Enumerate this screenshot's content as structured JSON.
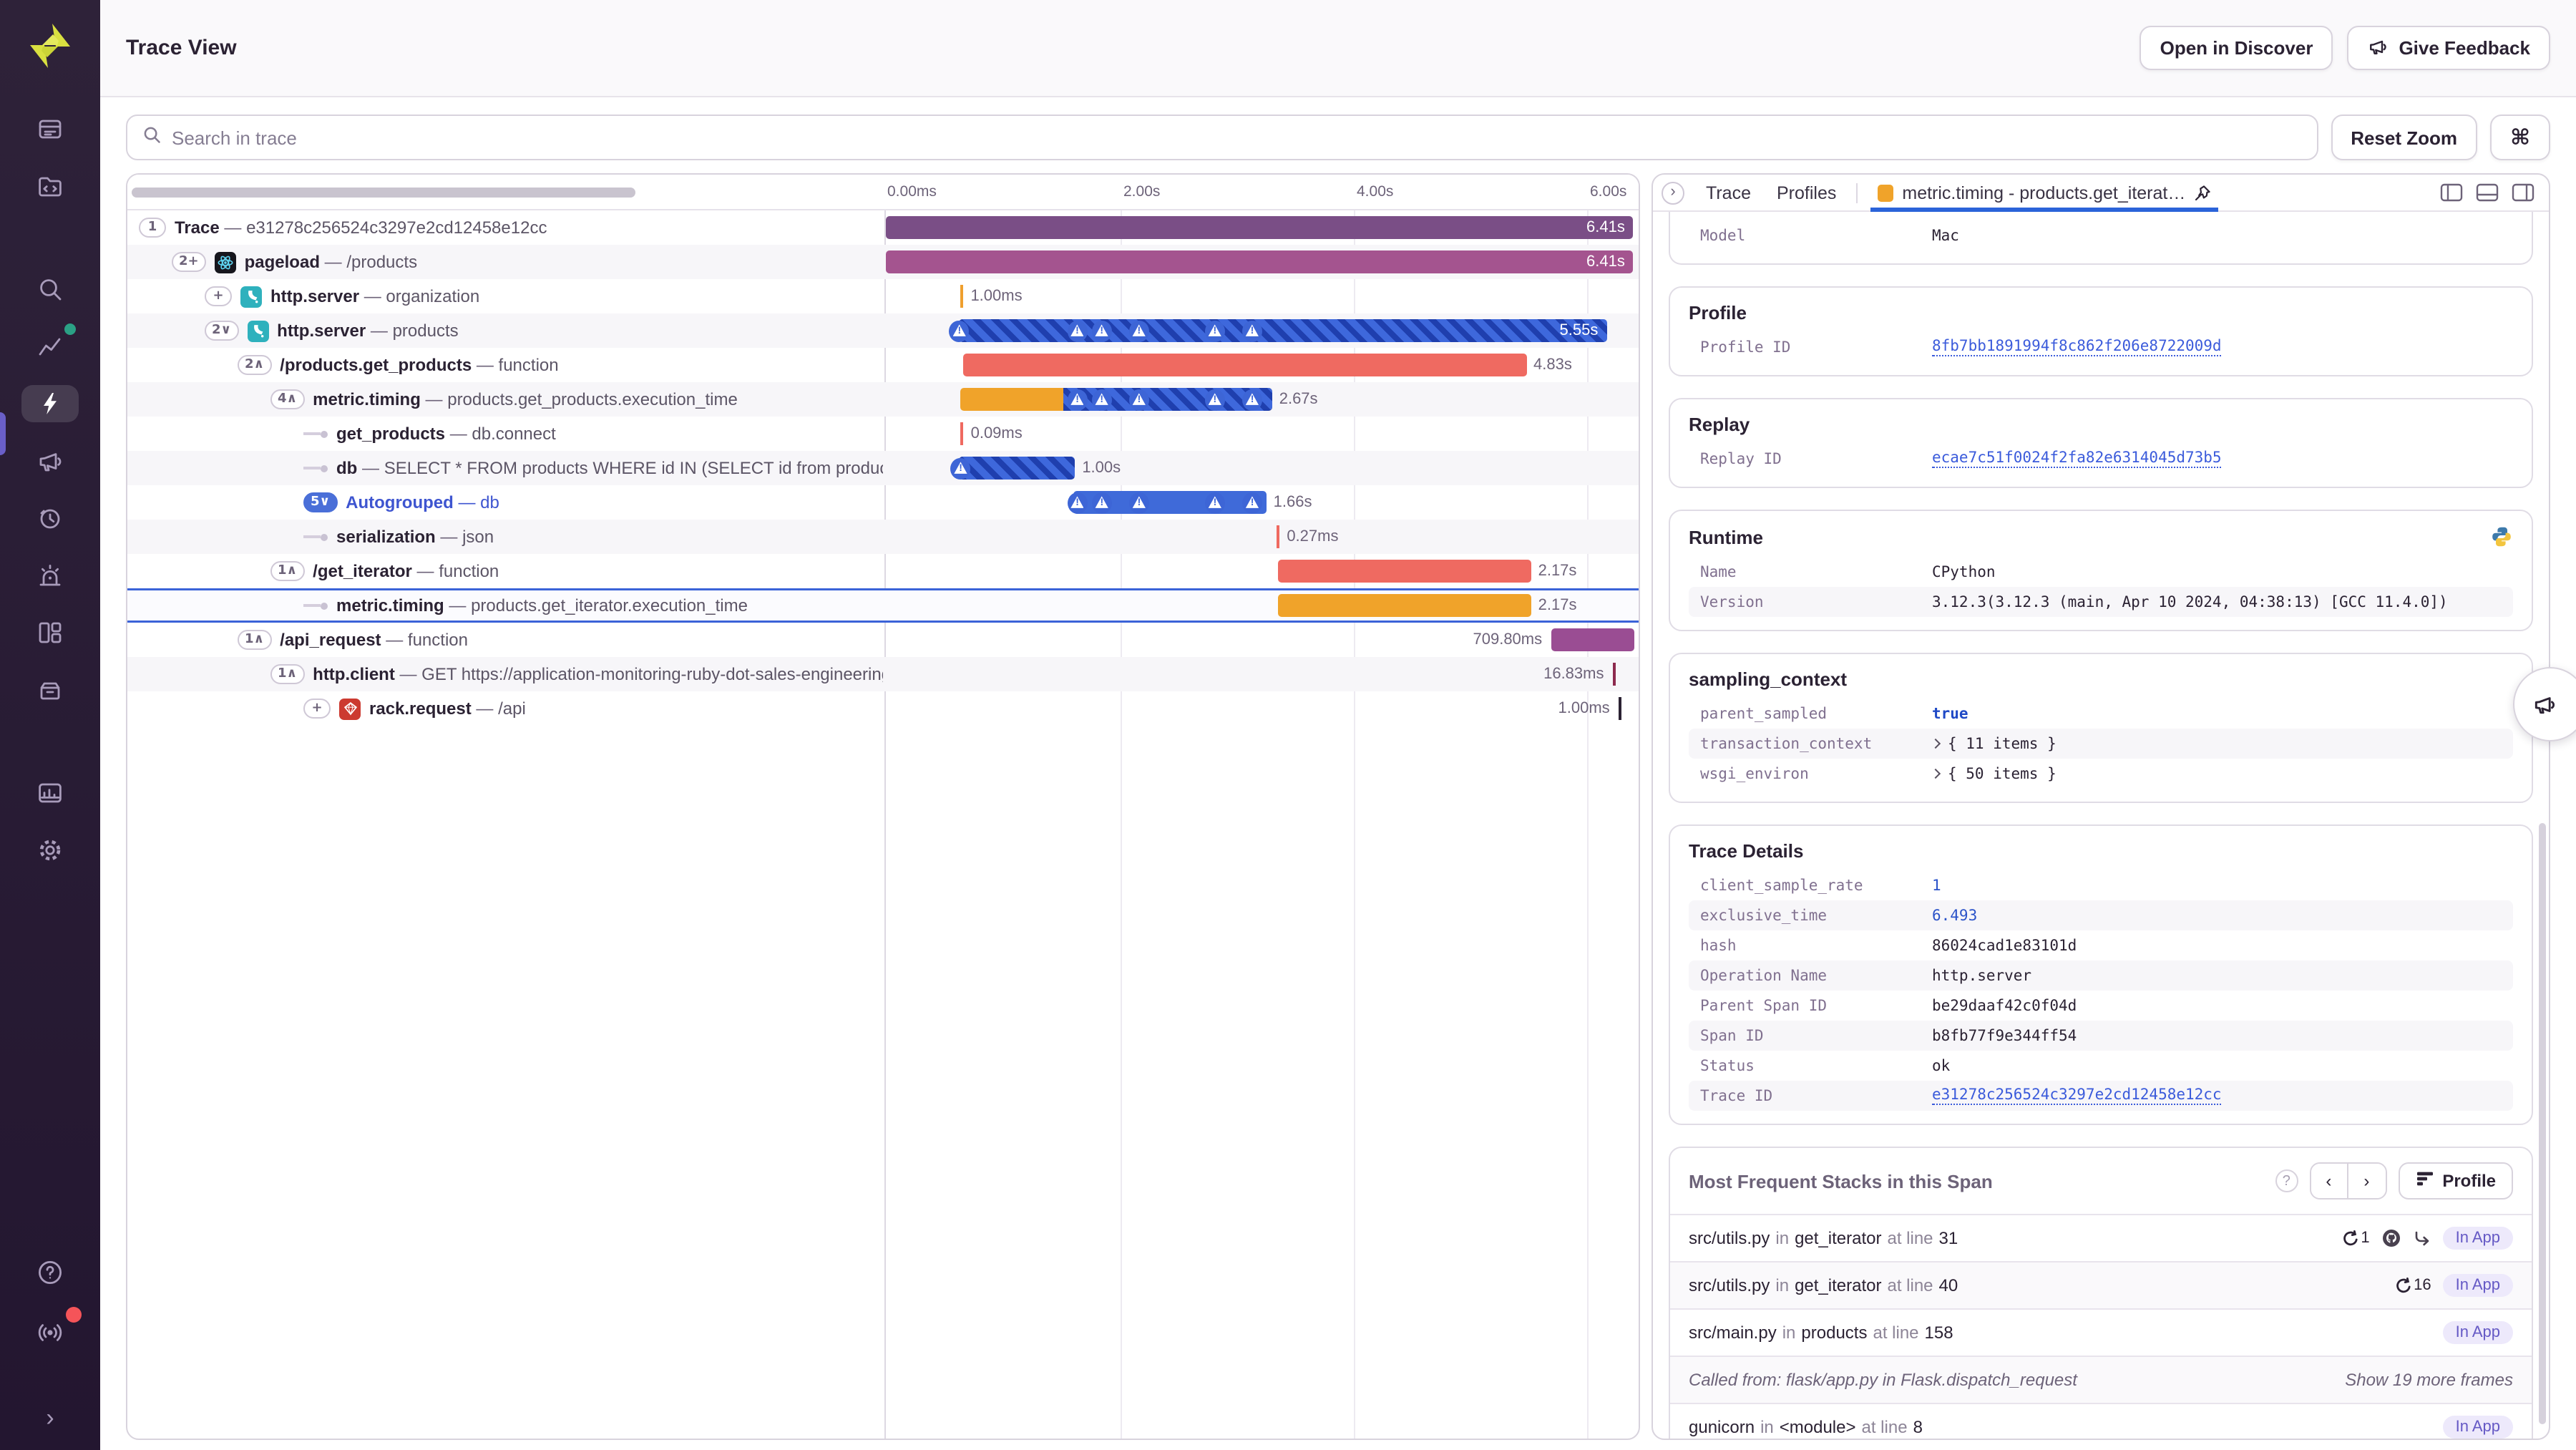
{
  "header": {
    "title": "Trace View",
    "open_discover": "Open in Discover",
    "give_feedback": "Give Feedback"
  },
  "toolbar": {
    "search_placeholder": "Search in trace",
    "reset_zoom": "Reset Zoom",
    "cmd": "⌘"
  },
  "sidebar": {
    "icons": [
      "issues",
      "projects",
      "search",
      "insights",
      "performance",
      "feedback",
      "replays",
      "alerts",
      "dashboards",
      "releases",
      "stats",
      "settings"
    ],
    "active": "performance",
    "bottom_icons": [
      "help",
      "broadcast",
      "collapse"
    ],
    "accent_dot": "#2ba185",
    "alert_dot": "#f55459"
  },
  "colors": {
    "accent_blue": "#3b63d8",
    "bar_trace": "#7a4e86",
    "bar_pageload": "#a4548f",
    "bar_salmon": "#ef6a61",
    "bar_amber": "#f0a32a",
    "bar_blue": "#3f6ad9",
    "bar_purple": "#9a4d93",
    "tick_orange": "#ef9f2e",
    "tick_red": "#ef6960",
    "tick_maroon": "#8d2a4e",
    "tick_dark": "#2b2233",
    "link": "#3b5bdb",
    "in_app_bg": "#ede9fb",
    "in_app_fg": "#6559c5",
    "tab_swatch": "#f0a32a"
  },
  "ruler": {
    "ticks": [
      {
        "label": "0.00ms",
        "s": 0
      },
      {
        "label": "2.00s",
        "s": 2
      },
      {
        "label": "4.00s",
        "s": 4
      },
      {
        "label": "6.00s",
        "s": 6
      }
    ]
  },
  "trace_rows": [
    {
      "badge": "1",
      "level": 0,
      "name": "Trace",
      "desc": "e31278c256524c3297e2cd12458e12cc",
      "bar": {
        "type": "bar",
        "start": 0,
        "dur": 6.41,
        "color": "bar_trace",
        "label": "6.41s",
        "label_pos": "in"
      }
    },
    {
      "badge": "2+",
      "level": 1,
      "icon": "react",
      "name": "pageload",
      "desc": "/products",
      "bar": {
        "type": "bar",
        "start": 0,
        "dur": 6.41,
        "color": "bar_pageload",
        "label": "6.41s",
        "label_pos": "in"
      }
    },
    {
      "badge": "+",
      "level": 2,
      "icon": "flask",
      "name": "http.server",
      "desc": "organization",
      "bar": {
        "type": "tick",
        "start": 0.64,
        "color": "tick_orange",
        "label": "1.00ms",
        "label_pos": "right"
      }
    },
    {
      "badge": "2∨",
      "level": 2,
      "icon": "flask",
      "name": "http.server",
      "desc": "products",
      "bar": {
        "type": "bar",
        "start": 0.63,
        "dur": 5.55,
        "striped": true,
        "label": "5.55s",
        "label_pos": "in",
        "warn": [
          0.63,
          1.64,
          1.85,
          2.17,
          2.82,
          3.14
        ]
      }
    },
    {
      "badge": "2∧",
      "level": 3,
      "name": "/products.get_products",
      "desc": "function",
      "bar": {
        "type": "bar",
        "start": 0.66,
        "dur": 4.83,
        "color": "bar_salmon",
        "label": "4.83s",
        "label_pos": "right"
      }
    },
    {
      "badge": "4∧",
      "level": 4,
      "name": "metric.timing",
      "desc": "products.get_products.execution_time",
      "bar": {
        "type": "bar",
        "start": 0.64,
        "dur": 2.67,
        "color": "bar_amber",
        "overlay_from": 0.33,
        "label": "2.67s",
        "label_pos": "right",
        "warn": [
          1.64,
          1.85,
          2.17,
          2.82,
          3.14
        ]
      }
    },
    {
      "badge": null,
      "level": 5,
      "name": "get_products",
      "desc": "db.connect",
      "bar": {
        "type": "tick",
        "start": 0.64,
        "color": "tick_red",
        "label": "0.09ms",
        "label_pos": "right"
      }
    },
    {
      "badge": null,
      "level": 5,
      "name": "db",
      "desc": "SELECT * FROM products WHERE id IN (SELECT id from products)",
      "bar": {
        "type": "bar",
        "start": 0.62,
        "dur": 1.0,
        "striped": true,
        "label": "1.00s",
        "label_pos": "right",
        "warn": [
          0.64
        ]
      }
    },
    {
      "badge": "5∨",
      "badge_blue": true,
      "blue": true,
      "level": 5,
      "name": "Autogrouped",
      "desc": "db",
      "bar": {
        "type": "bar",
        "start": 1.6,
        "dur": 1.66,
        "color": "bar_blue",
        "label": "1.66s",
        "label_pos": "right",
        "warn": [
          1.64,
          1.85,
          2.17,
          2.82,
          3.14
        ]
      }
    },
    {
      "badge": null,
      "level": 5,
      "name": "serialization",
      "desc": "json",
      "bar": {
        "type": "tick",
        "start": 3.35,
        "color": "tick_red",
        "label": "0.27ms",
        "label_pos": "right"
      }
    },
    {
      "badge": "1∧",
      "level": 4,
      "name": "/get_iterator",
      "desc": "function",
      "bar": {
        "type": "bar",
        "start": 3.36,
        "dur": 2.17,
        "color": "bar_salmon",
        "label": "2.17s",
        "label_pos": "right"
      }
    },
    {
      "badge": null,
      "level": 5,
      "selected": true,
      "name": "metric.timing",
      "desc": "products.get_iterator.execution_time",
      "bar": {
        "type": "bar",
        "start": 3.36,
        "dur": 2.17,
        "color": "bar_amber",
        "label": "2.17s",
        "label_pos": "right"
      }
    },
    {
      "badge": "1∧",
      "level": 3,
      "name": "/api_request",
      "desc": "function",
      "bar": {
        "type": "bar",
        "start": 5.7,
        "dur": 0.71,
        "color": "bar_purple",
        "label": "709.80ms",
        "label_pos": "left"
      }
    },
    {
      "badge": "1∧",
      "level": 4,
      "name": "http.client",
      "desc": "GET https://application-monitoring-ruby-dot-sales-engineering",
      "bar": {
        "type": "tick",
        "start": 6.23,
        "color": "tick_maroon",
        "label": "16.83ms",
        "label_pos": "left"
      }
    },
    {
      "badge": "+",
      "level": 5,
      "icon": "ruby",
      "name": "rack.request",
      "desc": "/api",
      "bar": {
        "type": "tick",
        "start": 6.28,
        "color": "tick_dark",
        "label": "1.00ms",
        "label_pos": "left"
      }
    }
  ],
  "tabs": {
    "items": [
      "Trace",
      "Profiles"
    ],
    "active": {
      "label": "metric.timing - products.get_iterat…",
      "pinned": true
    }
  },
  "panel_right": {
    "cards": [
      {
        "cut": true,
        "rows": [
          {
            "k": "Model",
            "v": "Mac",
            "t": "text"
          }
        ]
      },
      {
        "title": "Profile",
        "rows": [
          {
            "k": "Profile ID",
            "v": "8fb7bb1891994f8c862f206e8722009d",
            "t": "link"
          }
        ]
      },
      {
        "title": "Replay",
        "rows": [
          {
            "k": "Replay ID",
            "v": "ecae7c51f0024f2fa82e6314045d73b5",
            "t": "link"
          }
        ]
      },
      {
        "title": "Runtime",
        "icon": "python",
        "rows": [
          {
            "k": "Name",
            "v": "CPython",
            "t": "text"
          },
          {
            "k": "Version",
            "v": "3.12.3(3.12.3 (main, Apr 10 2024, 04:38:13) [GCC 11.4.0])",
            "t": "text"
          }
        ]
      },
      {
        "title": "sampling_context",
        "rows": [
          {
            "k": "parent_sampled",
            "v": "true",
            "t": "bool"
          },
          {
            "k": "transaction_context",
            "v": "{ 11 items }",
            "t": "expand"
          },
          {
            "k": "wsgi_environ",
            "v": "{ 50 items }",
            "t": "expand"
          }
        ]
      },
      {
        "title": "Trace Details",
        "rows": [
          {
            "k": "client_sample_rate",
            "v": "1",
            "t": "num"
          },
          {
            "k": "exclusive_time",
            "v": "6.493",
            "t": "num"
          },
          {
            "k": "hash",
            "v": "86024cad1e83101d",
            "t": "text"
          },
          {
            "k": "Operation Name",
            "v": "http.server",
            "t": "text"
          },
          {
            "k": "Parent Span ID",
            "v": "be29daaf42c0f04d",
            "t": "text"
          },
          {
            "k": "Span ID",
            "v": "b8fb77f9e344ff54",
            "t": "text"
          },
          {
            "k": "Status",
            "v": "ok",
            "t": "text"
          },
          {
            "k": "Trace ID",
            "v": "e31278c256524c3297e2cd12458e12cc",
            "t": "link"
          }
        ]
      }
    ],
    "stacks": {
      "title": "Most Frequent Stacks in this Span",
      "profile_label": "Profile",
      "in_app": "In App",
      "word_in": "in",
      "word_at": "at line",
      "frames": [
        {
          "file": "src/utils.py",
          "func": "get_iterator",
          "line": "31",
          "loop": "1",
          "github": true,
          "curve": true,
          "in_app": true
        },
        {
          "file": "src/utils.py",
          "func": "get_iterator",
          "line": "40",
          "loop": "16",
          "in_app": true
        },
        {
          "file": "src/main.py",
          "func": "products",
          "line": "158",
          "in_app": true
        },
        {
          "called_from": "Called from: flask/app.py in Flask.dispatch_request",
          "more": "Show 19 more frames"
        },
        {
          "file": "gunicorn",
          "func": "<module>",
          "line": "8",
          "in_app": true
        }
      ]
    }
  }
}
